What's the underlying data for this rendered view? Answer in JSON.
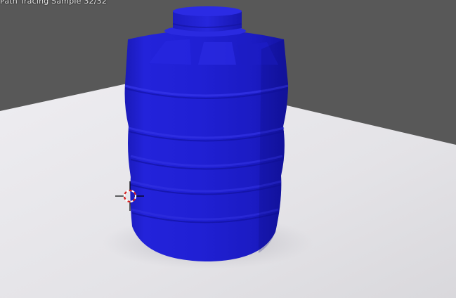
{
  "viewport": {
    "status_text": "Path Tracing Sample 32/32",
    "colors": {
      "background": "#585858",
      "floor": "#e4e3e7",
      "tank": "#1f1fd6",
      "cursor_ring": "#d42020",
      "cursor_cross": "#000000"
    },
    "scene_objects": [
      "water-tank",
      "floor-plane",
      "3d-cursor"
    ]
  }
}
